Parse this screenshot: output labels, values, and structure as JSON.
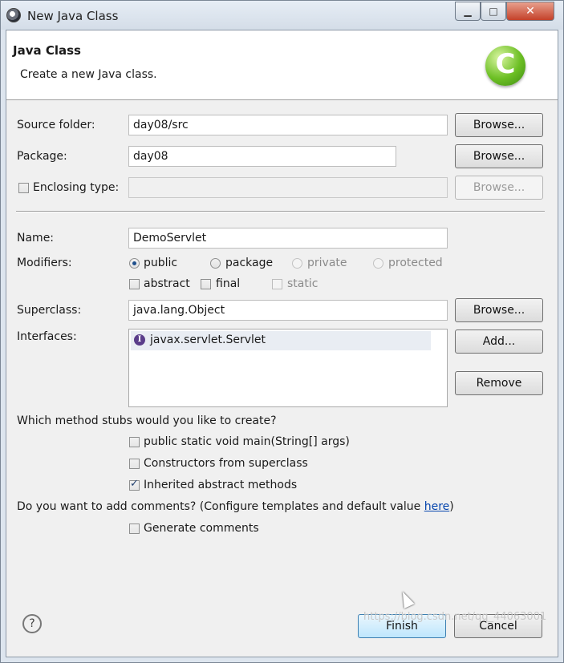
{
  "window": {
    "title": "New Java Class",
    "minimize_glyph": "▁",
    "maximize_glyph": "□",
    "close_glyph": "✕"
  },
  "banner": {
    "title": "Java Class",
    "description": "Create a new Java class.",
    "logo_letter": "C"
  },
  "form": {
    "source_folder_label": "Source folder:",
    "source_folder_value": "day08/src",
    "package_label": "Package:",
    "package_value": "day08",
    "enclosing_type_label": "Enclosing type:",
    "enclosing_type_value": "",
    "browse_label": "Browse...",
    "name_label": "Name:",
    "name_value": "DemoServlet",
    "modifiers_label": "Modifiers:",
    "modifiers": {
      "public": "public",
      "package": "package",
      "private": "private",
      "protected": "protected",
      "abstract": "abstract",
      "final": "final",
      "static": "static"
    },
    "superclass_label": "Superclass:",
    "superclass_value": "java.lang.Object",
    "interfaces_label": "Interfaces:",
    "interfaces": [
      "javax.servlet.Servlet"
    ],
    "interface_icon_letter": "I",
    "add_label": "Add...",
    "remove_label": "Remove"
  },
  "stubs": {
    "question": "Which method stubs would you like to create?",
    "main_label": "public static void main(String[] args)",
    "constructors_label": "Constructors from superclass",
    "inherited_label": "Inherited abstract methods"
  },
  "comments": {
    "question": "Do you want to add comments? (Configure templates and default value ",
    "link_text": "here",
    "question_end": ")",
    "generate_label": "Generate comments"
  },
  "footer": {
    "help_glyph": "?",
    "finish_label": "Finish",
    "cancel_label": "Cancel"
  },
  "watermark": "https://blog.csdn.net/qq_44063001"
}
